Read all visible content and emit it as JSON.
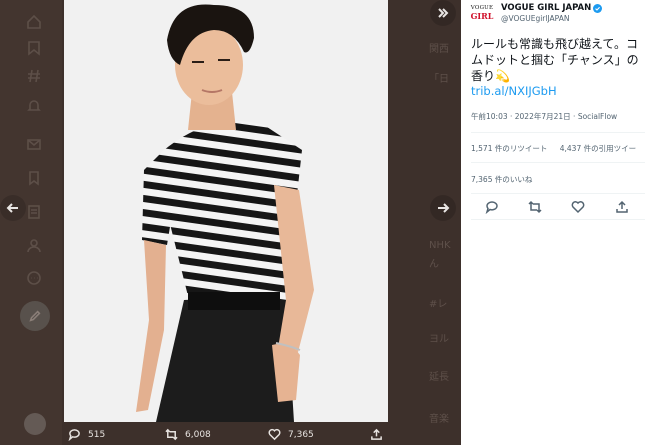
{
  "tweet": {
    "account_name": "VOGUE GIRL JAPAN",
    "handle": "@VOGUEgirlJAPAN",
    "logo_line1": "VOGUE",
    "logo_line2": "GIRL",
    "text": "ルールも常識も飛び越えて。コムドットと掴む「チャンス」の香り",
    "emoji": "💫",
    "link": "trib.al/NXIJGbH",
    "meta": "午前10:03 · 2022年7月21日 · SocialFlow",
    "retweets_label": "1,571 件のリツイート",
    "quotes_label": "4,437 件の引用ツイー",
    "likes_label": "7,365 件のいいね"
  },
  "media_actions": {
    "replies": "515",
    "retweets": "6,008",
    "likes": "7,365"
  },
  "colors": {
    "backdrop": "#3d302b",
    "link_blue": "#1d9bf0",
    "verified_blue": "#1d9bf0",
    "logo_red": "#d0112b"
  },
  "icons": {
    "prev": "arrow-left-icon",
    "next": "arrow-right-icon",
    "collapse": "double-chevron-right-icon",
    "reply": "reply-icon",
    "retweet": "retweet-icon",
    "like": "heart-icon",
    "share": "share-icon"
  }
}
